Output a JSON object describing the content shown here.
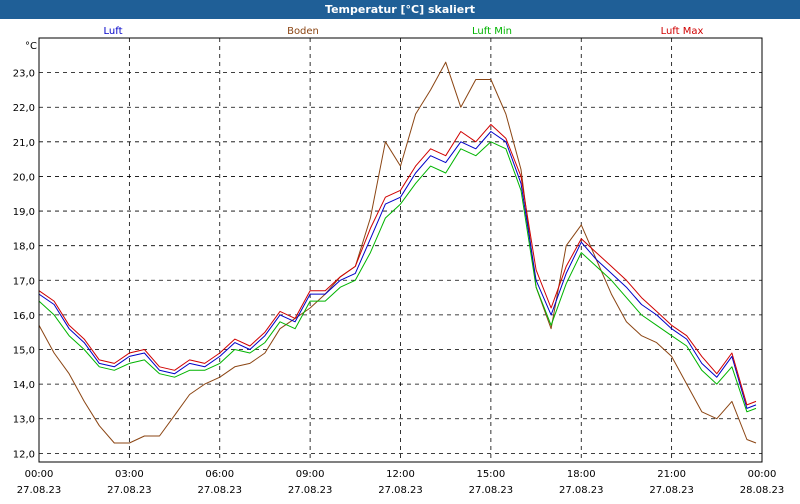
{
  "window": {
    "title": "Temperatur [°C] skaliert"
  },
  "colors": {
    "titlebar": "#1f5f97",
    "luft": "#0000c8",
    "boden": "#8b4513",
    "luft_min": "#00b400",
    "luft_max": "#d00000",
    "grid": "#000000"
  },
  "chart_data": {
    "type": "line",
    "title": "Temperatur [°C] skaliert",
    "ylabel": "°C",
    "xlabel": "",
    "ylim": [
      11.75,
      24.0
    ],
    "xlim": [
      0,
      24
    ],
    "grid": true,
    "legend_placement": "top",
    "y_ticks": [
      "12,0",
      "13,0",
      "14,0",
      "15,0",
      "16,0",
      "17,0",
      "18,0",
      "19,0",
      "20,0",
      "21,0",
      "22,0",
      "23,0"
    ],
    "y_tick_values": [
      12,
      13,
      14,
      15,
      16,
      17,
      18,
      19,
      20,
      21,
      22,
      23
    ],
    "x_ticks": [
      {
        "time": "00:00",
        "date": "27.08.23"
      },
      {
        "time": "03:00",
        "date": "27.08.23"
      },
      {
        "time": "06:00",
        "date": "27.08.23"
      },
      {
        "time": "09:00",
        "date": "27.08.23"
      },
      {
        "time": "12:00",
        "date": "27.08.23"
      },
      {
        "time": "15:00",
        "date": "27.08.23"
      },
      {
        "time": "18:00",
        "date": "27.08.23"
      },
      {
        "time": "21:00",
        "date": "27.08.23"
      },
      {
        "time": "00:00",
        "date": "28.08.23"
      }
    ],
    "x_tick_values": [
      0,
      3,
      6,
      9,
      12,
      15,
      18,
      21,
      24
    ],
    "series": [
      {
        "name": "Luft",
        "x": [
          0,
          0.5,
          1,
          1.5,
          2,
          2.5,
          3,
          3.5,
          4,
          4.5,
          5,
          5.5,
          6,
          6.5,
          7,
          7.5,
          8,
          8.5,
          9,
          9.5,
          10,
          10.5,
          11,
          11.5,
          12,
          12.5,
          13,
          13.5,
          14,
          14.5,
          15,
          15.5,
          16,
          16.5,
          17,
          17.5,
          18,
          18.5,
          19,
          19.5,
          20,
          20.5,
          21,
          21.5,
          22,
          22.5,
          23,
          23.5,
          23.8
        ],
        "values": [
          16.6,
          16.3,
          15.6,
          15.2,
          14.6,
          14.5,
          14.8,
          14.9,
          14.4,
          14.3,
          14.6,
          14.5,
          14.8,
          15.2,
          15.0,
          15.4,
          16.0,
          15.8,
          16.6,
          16.6,
          17.0,
          17.2,
          18.2,
          19.2,
          19.4,
          20.1,
          20.6,
          20.4,
          21.0,
          20.8,
          21.3,
          21.0,
          19.8,
          17.0,
          16.0,
          17.2,
          18.1,
          17.6,
          17.2,
          16.8,
          16.3,
          16.0,
          15.6,
          15.3,
          14.6,
          14.2,
          14.8,
          13.3,
          13.4
        ]
      },
      {
        "name": "Boden",
        "x": [
          0,
          0.5,
          1,
          1.5,
          2,
          2.5,
          3,
          3.5,
          4,
          4.5,
          5,
          5.5,
          6,
          6.5,
          7,
          7.5,
          8,
          8.5,
          9,
          9.5,
          10,
          10.5,
          11,
          11.5,
          12,
          12.5,
          13,
          13.5,
          14,
          14.5,
          15,
          15.5,
          16,
          16.5,
          17,
          17.5,
          18,
          18.5,
          19,
          19.5,
          20,
          20.5,
          21,
          21.5,
          22,
          22.5,
          23,
          23.5,
          23.8
        ],
        "values": [
          15.7,
          14.9,
          14.3,
          13.5,
          12.8,
          12.3,
          12.3,
          12.5,
          12.5,
          13.1,
          13.7,
          14.0,
          14.2,
          14.5,
          14.6,
          14.9,
          15.6,
          15.9,
          16.2,
          16.6,
          17.1,
          17.4,
          18.8,
          21.0,
          20.3,
          21.8,
          22.5,
          23.3,
          22.0,
          22.8,
          22.8,
          21.8,
          20.2,
          16.8,
          15.6,
          18.0,
          18.6,
          17.6,
          16.6,
          15.8,
          15.4,
          15.2,
          14.8,
          14.0,
          13.2,
          13.0,
          13.5,
          12.4,
          12.3
        ]
      },
      {
        "name": "Luft Min",
        "x": [
          0,
          0.5,
          1,
          1.5,
          2,
          2.5,
          3,
          3.5,
          4,
          4.5,
          5,
          5.5,
          6,
          6.5,
          7,
          7.5,
          8,
          8.5,
          9,
          9.5,
          10,
          10.5,
          11,
          11.5,
          12,
          12.5,
          13,
          13.5,
          14,
          14.5,
          15,
          15.5,
          16,
          16.5,
          17,
          17.5,
          18,
          18.5,
          19,
          19.5,
          20,
          20.5,
          21,
          21.5,
          22,
          22.5,
          23,
          23.5,
          23.8
        ],
        "values": [
          16.4,
          16.0,
          15.4,
          15.0,
          14.5,
          14.4,
          14.6,
          14.7,
          14.3,
          14.2,
          14.4,
          14.4,
          14.6,
          15.0,
          14.9,
          15.2,
          15.8,
          15.6,
          16.4,
          16.4,
          16.8,
          17.0,
          17.8,
          18.8,
          19.2,
          19.8,
          20.3,
          20.1,
          20.8,
          20.6,
          21.0,
          20.8,
          19.6,
          16.8,
          15.7,
          16.9,
          17.8,
          17.4,
          17.0,
          16.5,
          16.0,
          15.7,
          15.4,
          15.1,
          14.4,
          14.0,
          14.5,
          13.2,
          13.3
        ]
      },
      {
        "name": "Luft Max",
        "x": [
          0,
          0.5,
          1,
          1.5,
          2,
          2.5,
          3,
          3.5,
          4,
          4.5,
          5,
          5.5,
          6,
          6.5,
          7,
          7.5,
          8,
          8.5,
          9,
          9.5,
          10,
          10.5,
          11,
          11.5,
          12,
          12.5,
          13,
          13.5,
          14,
          14.5,
          15,
          15.5,
          16,
          16.5,
          17,
          17.5,
          18,
          18.5,
          19,
          19.5,
          20,
          20.5,
          21,
          21.5,
          22,
          22.5,
          23,
          23.5,
          23.8
        ],
        "values": [
          16.7,
          16.4,
          15.7,
          15.3,
          14.7,
          14.6,
          14.9,
          15.0,
          14.5,
          14.4,
          14.7,
          14.6,
          14.9,
          15.3,
          15.1,
          15.5,
          16.1,
          15.9,
          16.7,
          16.7,
          17.1,
          17.4,
          18.5,
          19.4,
          19.6,
          20.3,
          20.8,
          20.6,
          21.3,
          21.0,
          21.5,
          21.1,
          20.0,
          17.3,
          16.2,
          17.4,
          18.2,
          17.8,
          17.4,
          17.0,
          16.5,
          16.1,
          15.7,
          15.4,
          14.8,
          14.3,
          14.9,
          13.4,
          13.5
        ]
      }
    ]
  }
}
